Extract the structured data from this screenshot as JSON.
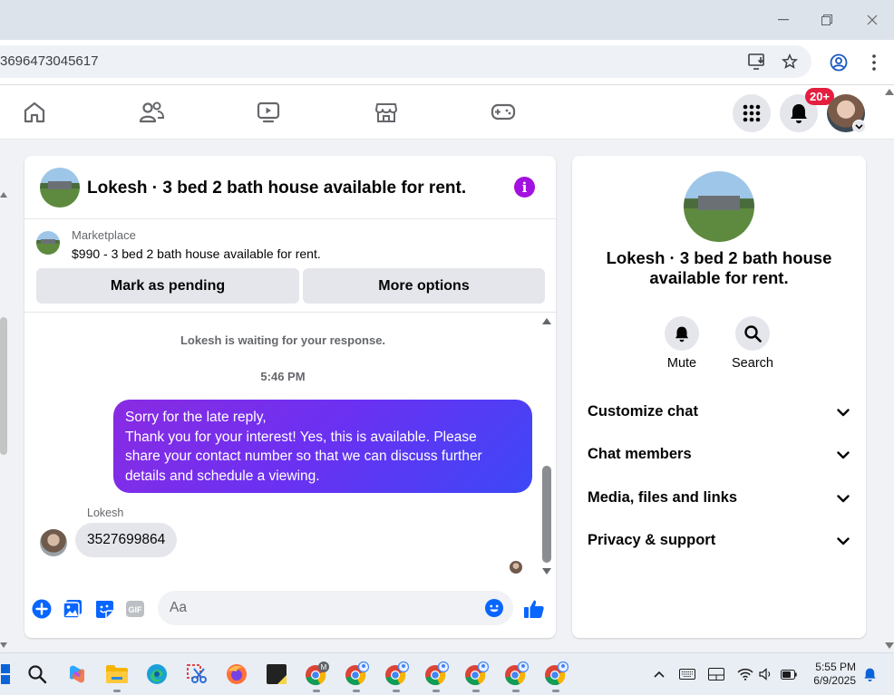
{
  "browser": {
    "url_fragment": "3696473045617"
  },
  "notifications": {
    "badge": "20+"
  },
  "chat": {
    "title": "Lokesh · 3 bed 2 bath house available for rent.",
    "marketplace_label": "Marketplace",
    "listing": "$990 - 3 bed 2 bath house available for rent.",
    "mark_pending_label": "Mark as pending",
    "more_options_label": "More options",
    "waiting_text": "Lokesh is waiting for your response.",
    "timestamp": "5:46 PM",
    "outgoing_message": [
      "Sorry for the late reply,",
      "Thank you for your interest! Yes, this is available. Please",
      "share your contact number so that we can discuss further",
      "details and schedule a viewing."
    ],
    "sender_name": "Lokesh",
    "incoming_message": "3527699864",
    "input_placeholder": "Aa"
  },
  "details_panel": {
    "title_line1": "Lokesh · 3 bed 2 bath house",
    "title_line2": "available for rent.",
    "mute_label": "Mute",
    "search_label": "Search",
    "sections": [
      {
        "label": "Customize chat"
      },
      {
        "label": "Chat members"
      },
      {
        "label": "Media, files and links"
      },
      {
        "label": "Privacy & support"
      }
    ]
  },
  "taskbar": {
    "time": "5:55 PM",
    "date": "6/9/2025"
  },
  "colors": {
    "accent": "#0866ff",
    "bubble_gradient_start": "#8a2be2",
    "bubble_gradient_end": "#3c48f7",
    "badge_red": "#e41e3f",
    "info_purple": "#a211e0"
  }
}
